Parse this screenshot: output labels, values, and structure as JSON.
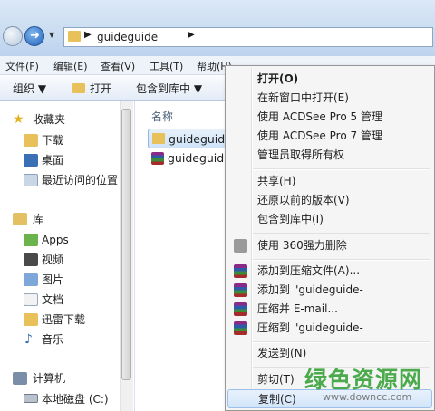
{
  "address": {
    "path": "guideguide"
  },
  "menubar": [
    "文件(F)",
    "编辑(E)",
    "查看(V)",
    "工具(T)",
    "帮助(H)"
  ],
  "toolbar": {
    "organize": "组织 ▼",
    "open": "打开",
    "include": "包含到库中 ▼"
  },
  "nav": {
    "favorites": "收藏夹",
    "fav_items": [
      "下载",
      "桌面",
      "最近访问的位置"
    ],
    "libraries": "库",
    "lib_items": [
      "Apps",
      "视频",
      "图片",
      "文档",
      "迅雷下载",
      "音乐"
    ],
    "computer": "计算机",
    "comp_items": [
      "本地磁盘 (C:)"
    ]
  },
  "main": {
    "column_name": "名称",
    "files": [
      "guideguide",
      "guideguide"
    ]
  },
  "context_menu": {
    "group1": [
      "打开(O)",
      "在新窗口中打开(E)",
      "使用 ACDSee Pro 5 管理",
      "使用 ACDSee Pro 7 管理",
      "管理员取得所有权"
    ],
    "group2": [
      "共享(H)",
      "还原以前的版本(V)",
      "包含到库中(I)"
    ],
    "group3": [
      "使用 360强力删除"
    ],
    "group4": [
      "添加到压缩文件(A)...",
      "添加到 \"guideguide-",
      "压缩并 E-mail...",
      "压缩到 \"guideguide-"
    ],
    "group5": [
      "发送到(N)"
    ],
    "group6": [
      "剪切(T)",
      "复制(C)"
    ]
  },
  "watermark": {
    "text": "绿色资源网",
    "url": "www.downcc.com"
  },
  "colors": {
    "accent": "#1f5fb8",
    "folder": "#e8c15a",
    "watermark": "#2e9e2e"
  }
}
